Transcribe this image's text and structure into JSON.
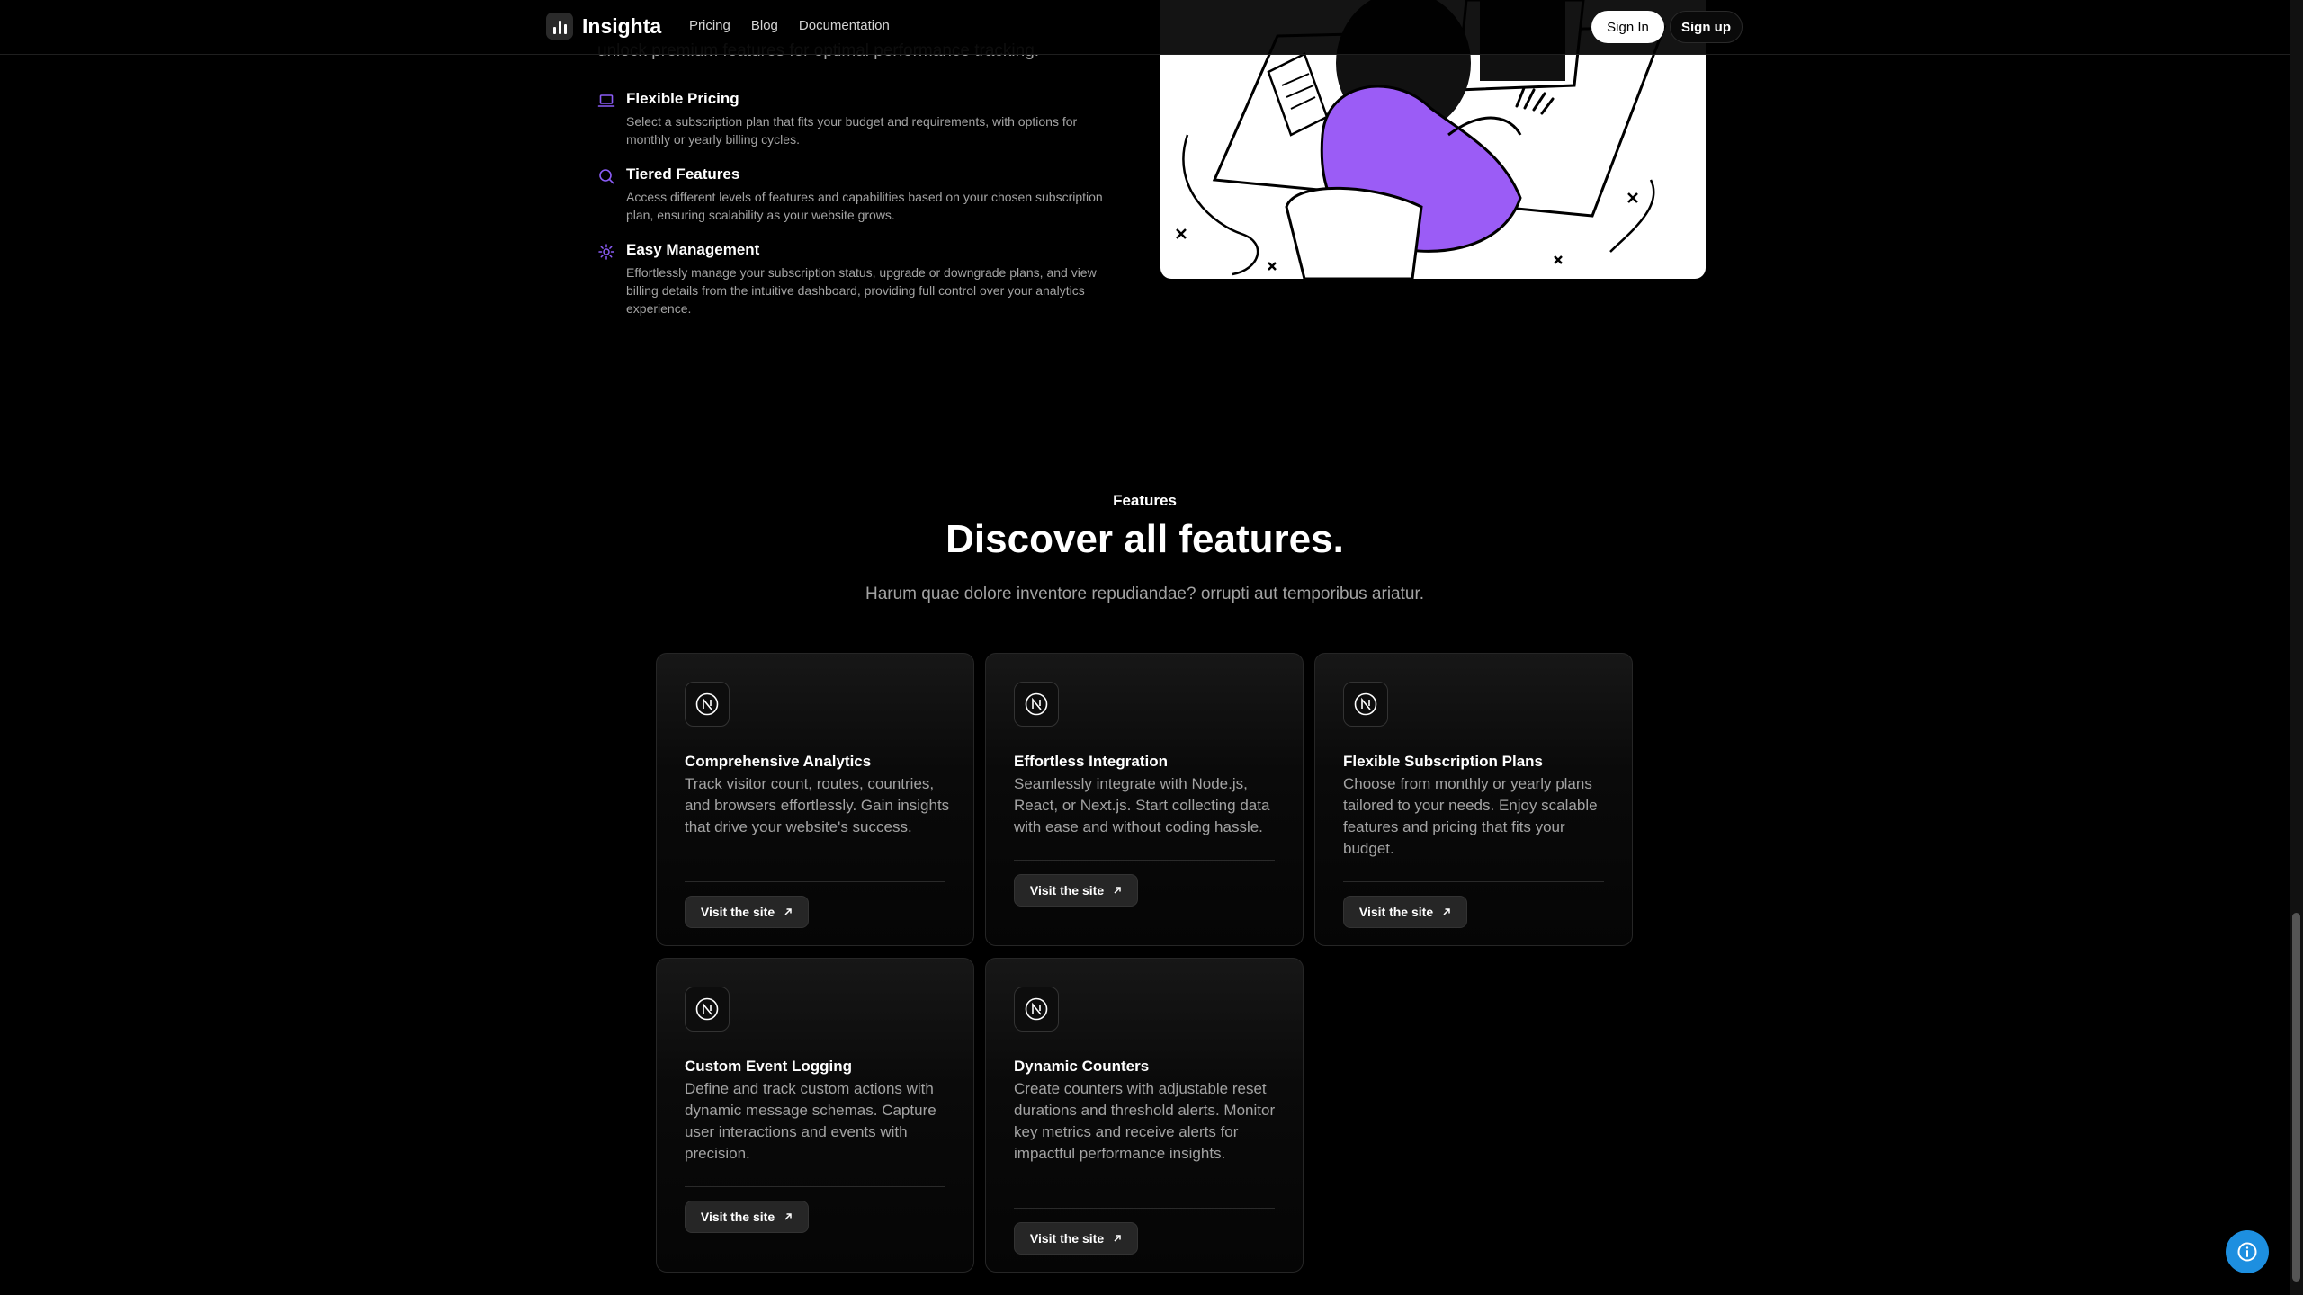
{
  "nav": {
    "brand": "Insighta",
    "links": [
      "Pricing",
      "Blog",
      "Documentation"
    ],
    "sign_in": "Sign In",
    "sign_up": "Sign up"
  },
  "intro": {
    "tail_text": "unlock premium features for optimal performance tracking."
  },
  "features_list": [
    {
      "icon": "laptop-icon",
      "title": "Flexible Pricing",
      "desc": "Select a subscription plan that fits your budget and requirements, with options for monthly or yearly billing cycles."
    },
    {
      "icon": "search-icon",
      "title": "Tiered Features",
      "desc": "Access different levels of features and capabilities based on your chosen subscription plan, ensuring scalability as your website grows."
    },
    {
      "icon": "gear-icon",
      "title": "Easy Management",
      "desc": "Effortlessly manage your subscription status, upgrade or downgrade plans, and view billing details from the intuitive dashboard, providing full control over your analytics experience."
    }
  ],
  "section": {
    "eyebrow": "Features",
    "title": "Discover all features.",
    "subtitle": "Harum quae dolore inventore repudiandae? orrupti aut temporibus ariatur."
  },
  "cards": [
    {
      "title": "Comprehensive Analytics",
      "desc": "Track visitor count, routes, countries, and browsers effortlessly. Gain insights that drive your website's success.",
      "button": "Visit the site"
    },
    {
      "title": "Effortless Integration",
      "desc": "Seamlessly integrate with Node.js, React, or Next.js. Start collecting data with ease and without coding hassle.",
      "button": "Visit the site"
    },
    {
      "title": "Flexible Subscription Plans",
      "desc": "Choose from monthly or yearly plans tailored to your needs. Enjoy scalable features and pricing that fits your budget.",
      "button": "Visit the site"
    },
    {
      "title": "Custom Event Logging",
      "desc": "Define and track custom actions with dynamic message schemas. Capture user interactions and events with precision.",
      "button": "Visit the site"
    },
    {
      "title": "Dynamic Counters",
      "desc": "Create counters with adjustable reset durations and threshold alerts. Monitor key metrics and receive alerts for impactful performance insights.",
      "button": "Visit the site"
    }
  ],
  "colors": {
    "accent": "#7c3aed",
    "help_button": "#1d8fe0",
    "background": "#000000"
  }
}
